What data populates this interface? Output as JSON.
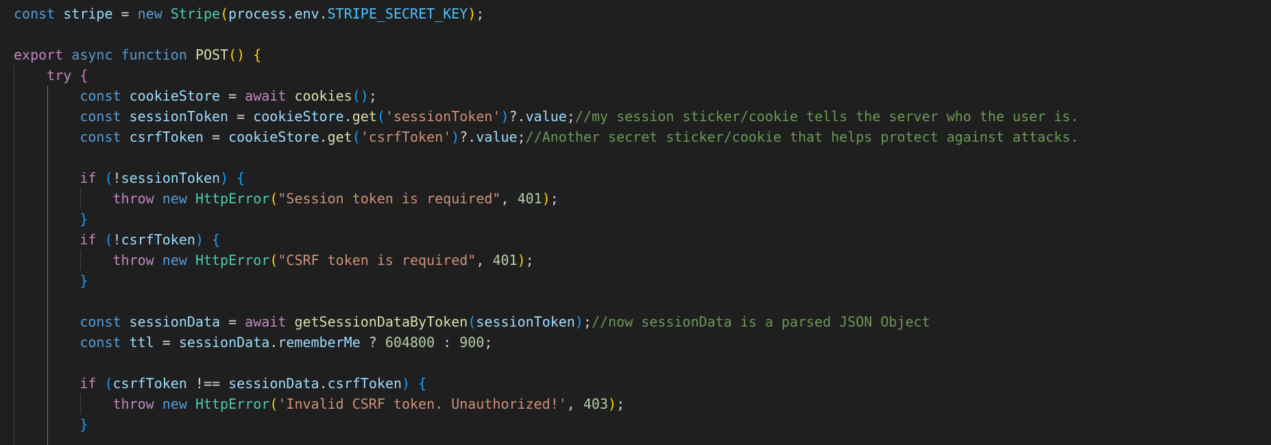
{
  "editor": {
    "language": "javascript",
    "theme_background": "#1f1f1f",
    "colors": {
      "keyword": "#569cd6",
      "control": "#c586c0",
      "variable": "#9cdcfe",
      "constant": "#4fc1ff",
      "class": "#4ec9b0",
      "function": "#dcdcaa",
      "string": "#ce9178",
      "number": "#b5cea8",
      "comment": "#6a9955",
      "bracket_level_1": "#ffd700",
      "bracket_level_2": "#da70d6",
      "bracket_level_3": "#179fff"
    },
    "lines": [
      [
        [
          "kw",
          "const"
        ],
        [
          "pun",
          " "
        ],
        [
          "var",
          "stripe"
        ],
        [
          "pun",
          " = "
        ],
        [
          "kw",
          "new"
        ],
        [
          "pun",
          " "
        ],
        [
          "cls",
          "Stripe"
        ],
        [
          "b1",
          "("
        ],
        [
          "var",
          "process"
        ],
        [
          "pun",
          "."
        ],
        [
          "var",
          "env"
        ],
        [
          "pun",
          "."
        ],
        [
          "const",
          "STRIPE_SECRET_KEY"
        ],
        [
          "b1",
          ")"
        ],
        [
          "pun",
          ";"
        ]
      ],
      [],
      [
        [
          "ctl",
          "export"
        ],
        [
          "pun",
          " "
        ],
        [
          "kw",
          "async"
        ],
        [
          "pun",
          " "
        ],
        [
          "kw",
          "function"
        ],
        [
          "pun",
          " "
        ],
        [
          "fn",
          "POST"
        ],
        [
          "b1",
          "()"
        ],
        [
          "pun",
          " "
        ],
        [
          "b1",
          "{"
        ]
      ],
      [
        [
          "pun",
          "    "
        ],
        [
          "ctl",
          "try"
        ],
        [
          "pun",
          " "
        ],
        [
          "b2",
          "{"
        ]
      ],
      [
        [
          "pun",
          "        "
        ],
        [
          "kw",
          "const"
        ],
        [
          "pun",
          " "
        ],
        [
          "var",
          "cookieStore"
        ],
        [
          "pun",
          " = "
        ],
        [
          "ctl",
          "await"
        ],
        [
          "pun",
          " "
        ],
        [
          "fn",
          "cookies"
        ],
        [
          "b3",
          "()"
        ],
        [
          "pun",
          ";"
        ]
      ],
      [
        [
          "pun",
          "        "
        ],
        [
          "kw",
          "const"
        ],
        [
          "pun",
          " "
        ],
        [
          "var",
          "sessionToken"
        ],
        [
          "pun",
          " = "
        ],
        [
          "var",
          "cookieStore"
        ],
        [
          "pun",
          "."
        ],
        [
          "fn",
          "get"
        ],
        [
          "b3",
          "("
        ],
        [
          "str",
          "'sessionToken'"
        ],
        [
          "b3",
          ")"
        ],
        [
          "pun",
          "?."
        ],
        [
          "var",
          "value"
        ],
        [
          "pun",
          ";"
        ],
        [
          "cmt",
          "//my session sticker/cookie tells the server who the user is."
        ]
      ],
      [
        [
          "pun",
          "        "
        ],
        [
          "kw",
          "const"
        ],
        [
          "pun",
          " "
        ],
        [
          "var",
          "csrfToken"
        ],
        [
          "pun",
          " = "
        ],
        [
          "var",
          "cookieStore"
        ],
        [
          "pun",
          "."
        ],
        [
          "fn",
          "get"
        ],
        [
          "b3",
          "("
        ],
        [
          "str",
          "'csrfToken'"
        ],
        [
          "b3",
          ")"
        ],
        [
          "pun",
          "?."
        ],
        [
          "var",
          "value"
        ],
        [
          "pun",
          ";"
        ],
        [
          "cmt",
          "//Another secret sticker/cookie that helps protect against attacks."
        ]
      ],
      [],
      [
        [
          "pun",
          "        "
        ],
        [
          "ctl",
          "if"
        ],
        [
          "pun",
          " "
        ],
        [
          "b3",
          "("
        ],
        [
          "pun",
          "!"
        ],
        [
          "var",
          "sessionToken"
        ],
        [
          "b3",
          ")"
        ],
        [
          "pun",
          " "
        ],
        [
          "b3",
          "{"
        ]
      ],
      [
        [
          "pun",
          "            "
        ],
        [
          "ctl",
          "throw"
        ],
        [
          "pun",
          " "
        ],
        [
          "kw",
          "new"
        ],
        [
          "pun",
          " "
        ],
        [
          "cls",
          "HttpError"
        ],
        [
          "b1",
          "("
        ],
        [
          "str",
          "\"Session token is required\""
        ],
        [
          "pun",
          ", "
        ],
        [
          "num",
          "401"
        ],
        [
          "b1",
          ")"
        ],
        [
          "pun",
          ";"
        ]
      ],
      [
        [
          "pun",
          "        "
        ],
        [
          "b3",
          "}"
        ]
      ],
      [
        [
          "pun",
          "        "
        ],
        [
          "ctl",
          "if"
        ],
        [
          "pun",
          " "
        ],
        [
          "b3",
          "("
        ],
        [
          "pun",
          "!"
        ],
        [
          "var",
          "csrfToken"
        ],
        [
          "b3",
          ")"
        ],
        [
          "pun",
          " "
        ],
        [
          "b3",
          "{"
        ]
      ],
      [
        [
          "pun",
          "            "
        ],
        [
          "ctl",
          "throw"
        ],
        [
          "pun",
          " "
        ],
        [
          "kw",
          "new"
        ],
        [
          "pun",
          " "
        ],
        [
          "cls",
          "HttpError"
        ],
        [
          "b1",
          "("
        ],
        [
          "str",
          "\"CSRF token is required\""
        ],
        [
          "pun",
          ", "
        ],
        [
          "num",
          "401"
        ],
        [
          "b1",
          ")"
        ],
        [
          "pun",
          ";"
        ]
      ],
      [
        [
          "pun",
          "        "
        ],
        [
          "b3",
          "}"
        ]
      ],
      [],
      [
        [
          "pun",
          "        "
        ],
        [
          "kw",
          "const"
        ],
        [
          "pun",
          " "
        ],
        [
          "var",
          "sessionData"
        ],
        [
          "pun",
          " = "
        ],
        [
          "ctl",
          "await"
        ],
        [
          "pun",
          " "
        ],
        [
          "fn",
          "getSessionDataByToken"
        ],
        [
          "b3",
          "("
        ],
        [
          "var",
          "sessionToken"
        ],
        [
          "b3",
          ")"
        ],
        [
          "pun",
          ";"
        ],
        [
          "cmt",
          "//now sessionData is a parsed JSON Object"
        ]
      ],
      [
        [
          "pun",
          "        "
        ],
        [
          "kw",
          "const"
        ],
        [
          "pun",
          " "
        ],
        [
          "var",
          "ttl"
        ],
        [
          "pun",
          " = "
        ],
        [
          "var",
          "sessionData"
        ],
        [
          "pun",
          "."
        ],
        [
          "var",
          "rememberMe"
        ],
        [
          "pun",
          " ? "
        ],
        [
          "num",
          "604800"
        ],
        [
          "pun",
          " : "
        ],
        [
          "num",
          "900"
        ],
        [
          "pun",
          ";"
        ]
      ],
      [],
      [
        [
          "pun",
          "        "
        ],
        [
          "ctl",
          "if"
        ],
        [
          "pun",
          " "
        ],
        [
          "b3",
          "("
        ],
        [
          "var",
          "csrfToken"
        ],
        [
          "pun",
          " !== "
        ],
        [
          "var",
          "sessionData"
        ],
        [
          "pun",
          "."
        ],
        [
          "var",
          "csrfToken"
        ],
        [
          "b3",
          ")"
        ],
        [
          "pun",
          " "
        ],
        [
          "b3",
          "{"
        ]
      ],
      [
        [
          "pun",
          "            "
        ],
        [
          "ctl",
          "throw"
        ],
        [
          "pun",
          " "
        ],
        [
          "kw",
          "new"
        ],
        [
          "pun",
          " "
        ],
        [
          "cls",
          "HttpError"
        ],
        [
          "b1",
          "("
        ],
        [
          "str",
          "'Invalid CSRF token. Unauthorized!'"
        ],
        [
          "pun",
          ", "
        ],
        [
          "num",
          "403"
        ],
        [
          "b1",
          ")"
        ],
        [
          "pun",
          ";"
        ]
      ],
      [
        [
          "pun",
          "        "
        ],
        [
          "b3",
          "}"
        ]
      ]
    ]
  }
}
